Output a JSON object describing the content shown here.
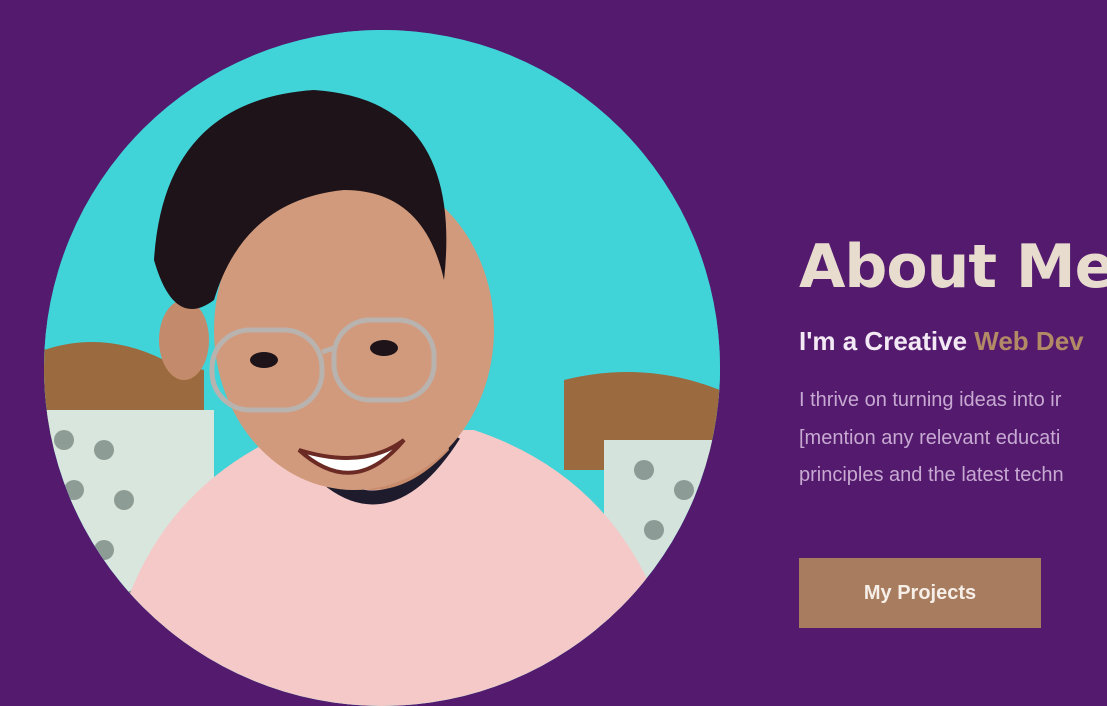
{
  "photo": {
    "name": "profile-photo"
  },
  "about": {
    "title": "About Me",
    "subtitle_prefix": "I'm a Creative ",
    "subtitle_accent": "Web Dev",
    "description_lines": [
      "I thrive on turning ideas into ir",
      "[mention any relevant educati",
      "principles and the latest techn"
    ],
    "button_label": "My Projects"
  },
  "colors": {
    "background": "#531a6e",
    "accent": "#b38a66",
    "button": "#a87c5f",
    "title": "#e7dccd",
    "description": "#c7a9d1"
  }
}
